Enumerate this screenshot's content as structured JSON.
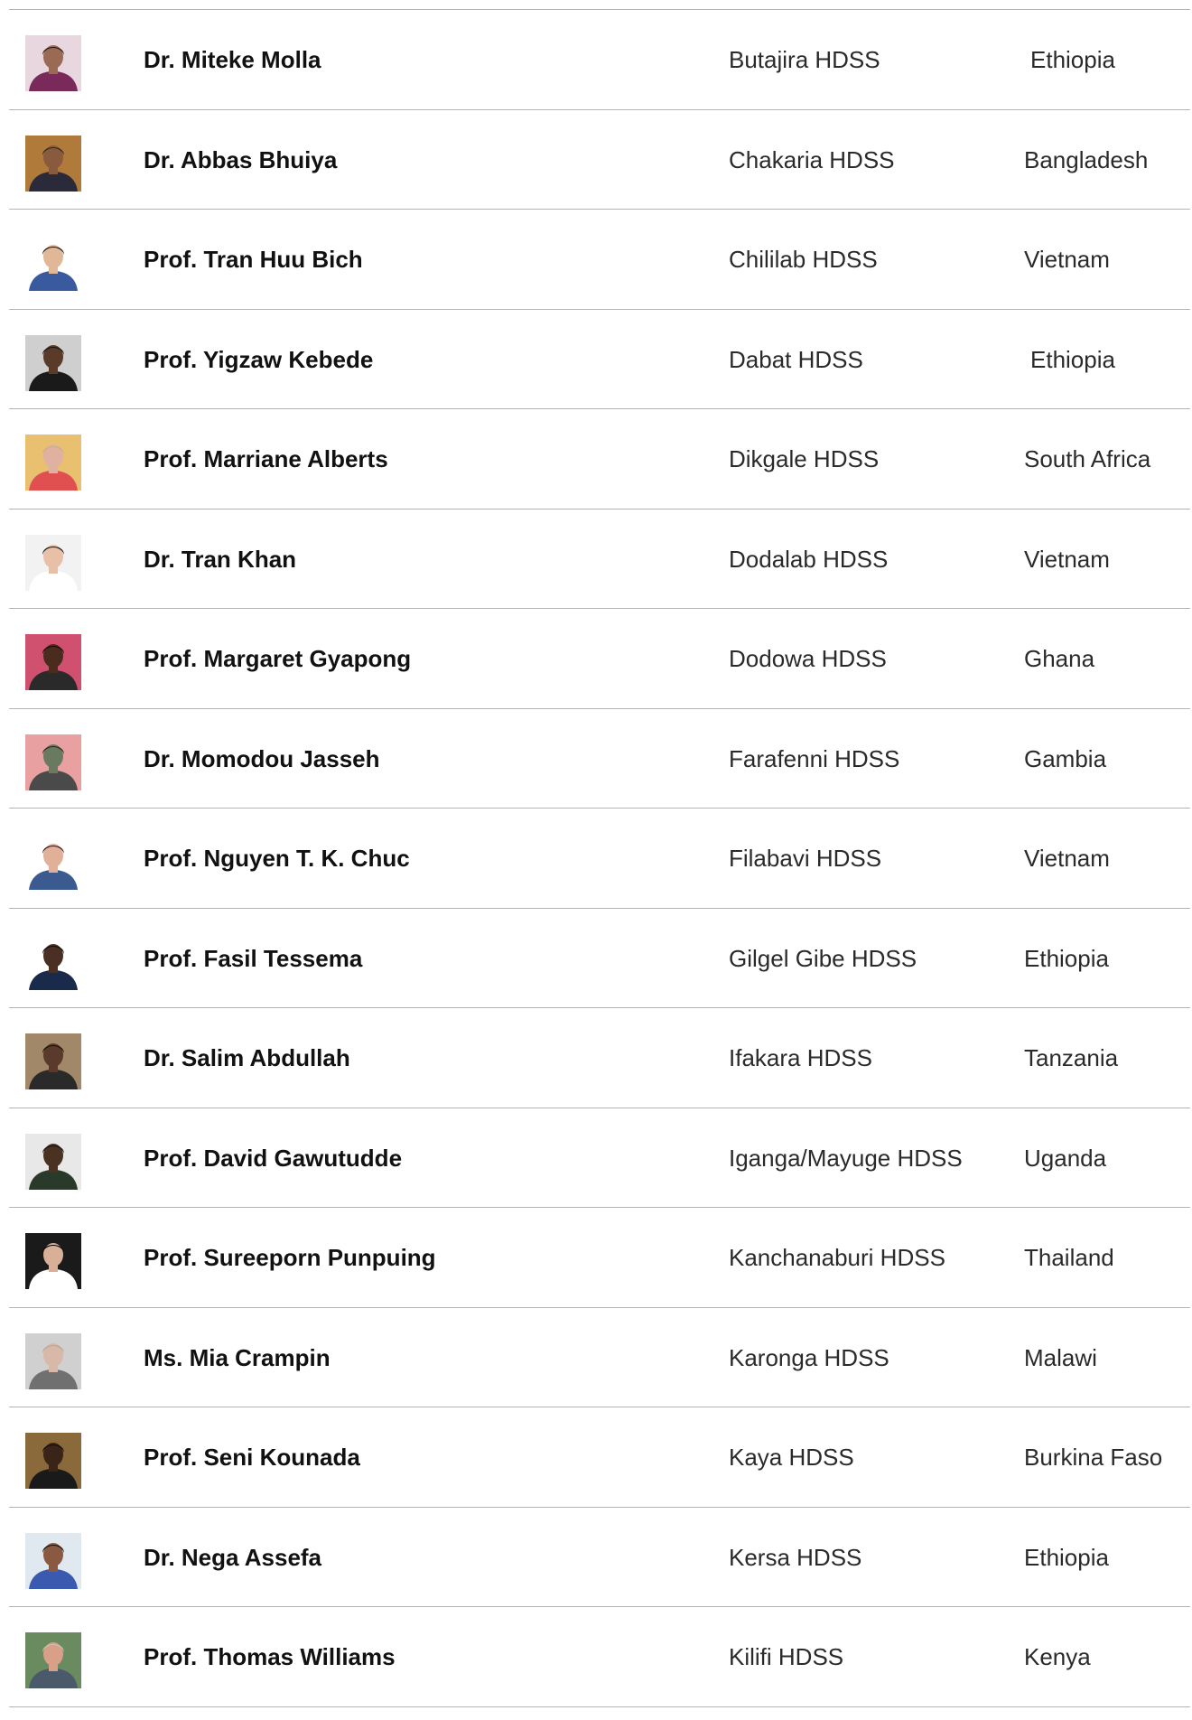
{
  "people": [
    {
      "name": "Dr. Miteke Molla",
      "site": "Butajira HDSS",
      "country": "Ethiopia",
      "photo": {
        "bg": "#e9d7df",
        "skin": "#9a6a55",
        "hair": "#2a1a16",
        "cloth": "#7a2a5a"
      }
    },
    {
      "name": "Dr. Abbas Bhuiya",
      "site": "Chakaria HDSS",
      "country": "Bangladesh",
      "photo": {
        "bg": "#b07a3a",
        "skin": "#8a5a3e",
        "hair": "#2a2a2a",
        "cloth": "#2a2a3a"
      }
    },
    {
      "name": "Prof. Tran Huu Bich",
      "site": "Chililab HDSS",
      "country": "Vietnam",
      "photo": {
        "bg": "#ffffff",
        "skin": "#e0b898",
        "hair": "#1a1a1a",
        "cloth": "#3a5aa0"
      }
    },
    {
      "name": "Prof. Yigzaw Kebede",
      "site": "Dabat HDSS",
      "country": "Ethiopia",
      "photo": {
        "bg": "#cfcfcf",
        "skin": "#5a3a28",
        "hair": "#1a1410",
        "cloth": "#1a1a1a"
      }
    },
    {
      "name": "Prof. Marriane Alberts",
      "site": "Dikgale HDSS",
      "country": "South Africa",
      "photo": {
        "bg": "#e8c070",
        "skin": "#e0b0a0",
        "hair": "#c8b088",
        "cloth": "#e05050"
      }
    },
    {
      "name": "Dr. Tran Khan",
      "site": "Dodalab HDSS",
      "country": "Vietnam",
      "photo": {
        "bg": "#f2f2f2",
        "skin": "#e8c0a8",
        "hair": "#1a1a1a",
        "cloth": "#ffffff"
      }
    },
    {
      "name": "Prof. Margaret Gyapong",
      "site": "Dodowa HDSS",
      "country": "Ghana",
      "photo": {
        "bg": "#d05070",
        "skin": "#4a2c1e",
        "hair": "#120c0a",
        "cloth": "#2a2a2a"
      }
    },
    {
      "name": "Dr. Momodou Jasseh",
      "site": "Farafenni HDSS",
      "country": "Gambia",
      "photo": {
        "bg": "#e8a0a0",
        "skin": "#6a7a60",
        "hair": "#2a2a20",
        "cloth": "#4a4a4a"
      }
    },
    {
      "name": "Prof. Nguyen T. K. Chuc",
      "site": "Filabavi HDSS",
      "country": "Vietnam",
      "photo": {
        "bg": "#ffffff",
        "skin": "#e0b098",
        "hair": "#3a1a14",
        "cloth": "#3a5a90"
      }
    },
    {
      "name": "Prof. Fasil Tessema",
      "site": "Gilgel Gibe HDSS",
      "country": "Ethiopia",
      "photo": {
        "bg": "#ffffff",
        "skin": "#4a3024",
        "hair": "#120c0a",
        "cloth": "#1a2a4a"
      }
    },
    {
      "name": "Dr. Salim Abdullah",
      "site": "Ifakara HDSS",
      "country": "Tanzania",
      "photo": {
        "bg": "#a08868",
        "skin": "#5a3a2a",
        "hair": "#1a120e",
        "cloth": "#2a2a2a"
      }
    },
    {
      "name": "Prof. David Gawutudde",
      "site": "Iganga/Mayuge HDSS",
      "country": "Uganda",
      "photo": {
        "bg": "#e8e8e8",
        "skin": "#4a3222",
        "hair": "#1a120e",
        "cloth": "#2a3a2a"
      }
    },
    {
      "name": "Prof. Sureeporn Punpuing",
      "site": "Kanchanaburi HDSS",
      "country": "Thailand",
      "photo": {
        "bg": "#1a1a1a",
        "skin": "#d8b098",
        "hair": "#0a0a0a",
        "cloth": "#ffffff"
      }
    },
    {
      "name": "Ms. Mia Crampin",
      "site": "Karonga HDSS",
      "country": "Malawi",
      "photo": {
        "bg": "#d0d0d0",
        "skin": "#d8b8a8",
        "hair": "#b8a890",
        "cloth": "#707070"
      }
    },
    {
      "name": "Prof. Seni Kounada",
      "site": "Kaya HDSS",
      "country": "Burkina Faso",
      "photo": {
        "bg": "#8a6a3a",
        "skin": "#3a2418",
        "hair": "#120c0a",
        "cloth": "#1a1a1a"
      }
    },
    {
      "name": "Dr. Nega Assefa",
      "site": "Kersa HDSS",
      "country": "Ethiopia",
      "photo": {
        "bg": "#e0e8f0",
        "skin": "#8a5a40",
        "hair": "#1a120e",
        "cloth": "#3a5ab0"
      }
    },
    {
      "name": "Prof. Thomas Williams",
      "site": "Kilifi HDSS",
      "country": "Kenya",
      "photo": {
        "bg": "#6a8a60",
        "skin": "#d8a088",
        "hair": "#c8c0b0",
        "cloth": "#4a5a6a"
      }
    }
  ]
}
